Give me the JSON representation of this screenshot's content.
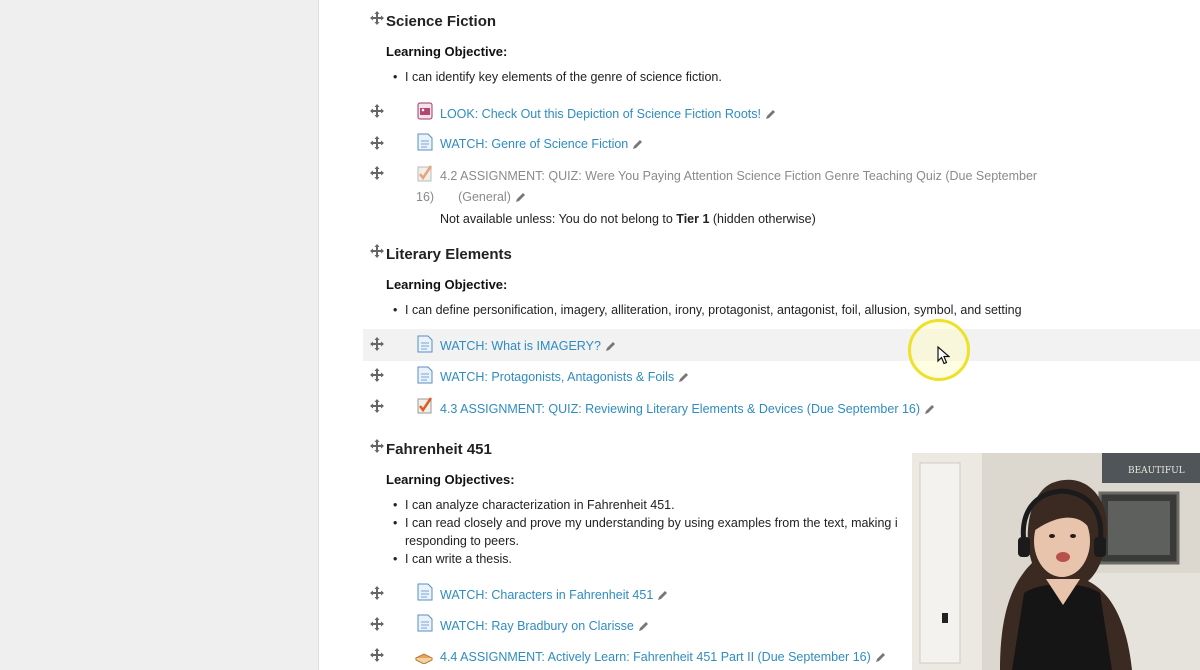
{
  "sections": [
    {
      "title": "Science Fiction",
      "objective_label": "Learning Objective:",
      "objectives": [
        "I can identify key elements of the genre of science fiction."
      ],
      "activities": [
        {
          "icon": "image-icon",
          "label": "LOOK: Check Out this Depiction of Science Fiction Roots!"
        },
        {
          "icon": "page-icon",
          "label": "WATCH: Genre of Science Fiction"
        },
        {
          "icon": "quiz-icon",
          "label_line1": "4.2 ASSIGNMENT: QUIZ: Were You Paying Attention Science Fiction Genre Teaching Quiz (Due September",
          "label_line2_prefix": "16)",
          "label_line2": "(General)",
          "restriction_prefix": "Not available unless: You do not belong to ",
          "restriction_bold": "Tier 1",
          "restriction_suffix": " (hidden otherwise)"
        }
      ]
    },
    {
      "title": "Literary Elements",
      "objective_label": "Learning Objective:",
      "objectives": [
        "I can define personification, imagery, alliteration, irony, protagonist, antagonist, foil, allusion, symbol, and setting"
      ],
      "activities": [
        {
          "icon": "page-icon",
          "label": "WATCH: What is IMAGERY?"
        },
        {
          "icon": "page-icon",
          "label": "WATCH: Protagonists, Antagonists & Foils"
        },
        {
          "icon": "quiz-icon",
          "label": "4.3 ASSIGNMENT: QUIZ: Reviewing Literary Elements & Devices (Due September 16)"
        }
      ]
    },
    {
      "title": "Fahrenheit 451",
      "objective_label": "Learning Objectives:",
      "objectives": [
        "I can analyze characterization in Fahrenheit 451.",
        "I can read closely and prove my understanding by using examples from the text, making i",
        "responding to peers.",
        "I can write a thesis."
      ],
      "activities": [
        {
          "icon": "page-icon",
          "label": "WATCH: Characters in Fahrenheit 451"
        },
        {
          "icon": "page-icon",
          "label": "WATCH: Ray Bradbury on Clarisse"
        },
        {
          "icon": "book-icon",
          "label": "4.4 ASSIGNMENT: Actively Learn: Fahrenheit 451 Part II (Due September 16)"
        }
      ]
    }
  ],
  "webcam": {
    "sign_text": "BEAUTIFUL"
  },
  "colors": {
    "link": "#2f8cc0",
    "dim_link": "#8a8a8a",
    "highlight_row": "#f2f2f2",
    "cursor_ring": "#eee12a"
  }
}
